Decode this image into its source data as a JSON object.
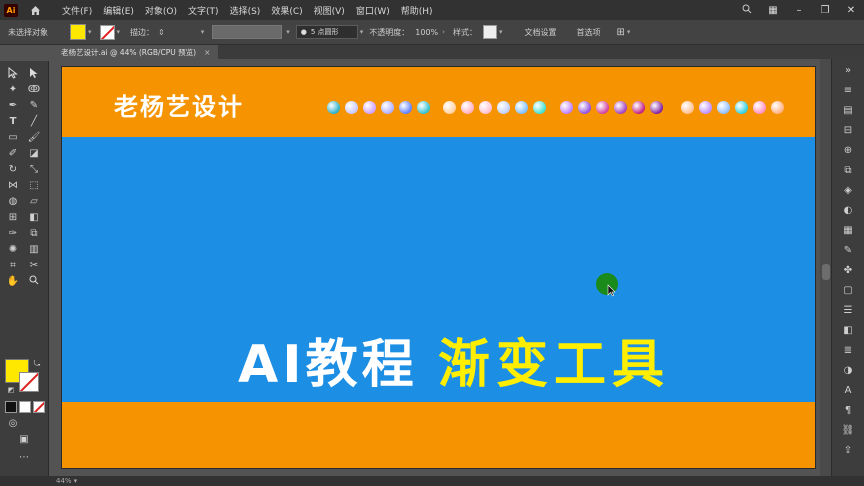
{
  "app": {
    "logo": "Ai",
    "menu": [
      "文件(F)",
      "编辑(E)",
      "对象(O)",
      "文字(T)",
      "选择(S)",
      "效果(C)",
      "视图(V)",
      "窗口(W)",
      "帮助(H)"
    ]
  },
  "control_bar": {
    "selection_label": "未选择对象",
    "stroke_label": "描边：",
    "brush_label": "5 点圆形",
    "opacity_label": "不透明度：",
    "opacity_value": "100%",
    "style_label": "样式：",
    "doc_setup": "文档设置",
    "preferences": "首选项"
  },
  "document_tab": {
    "title": "老杨艺设计.ai @ 44% (RGB/CPU 预览)",
    "close": "×"
  },
  "artwork": {
    "brand": "老杨艺设计",
    "headline_white": "AI教程",
    "headline_yellow": "渐变工具",
    "dot_colors": [
      "#2ab0c8",
      "#c8c8ff",
      "#d0a0ff",
      "#b0b0ff",
      "#6080ff",
      "#30c0d0",
      "#ffd0a0",
      "#ffb0c0",
      "#ffc0d0",
      "#c0d0ff",
      "#80c0ff",
      "#40e0d0",
      "#c080ff",
      "#9050e0",
      "#d040a0",
      "#a040c0",
      "#c02080",
      "#8020a0",
      "#ffc090",
      "#c090ff",
      "#90c0ff",
      "#30d0e0",
      "#ff90c0",
      "#ffb080"
    ]
  },
  "colors": {
    "orange": "#f59400",
    "blue": "#1c8ee4",
    "yellow": "#ffee00"
  },
  "status_bar": {
    "zoom": "44%"
  }
}
